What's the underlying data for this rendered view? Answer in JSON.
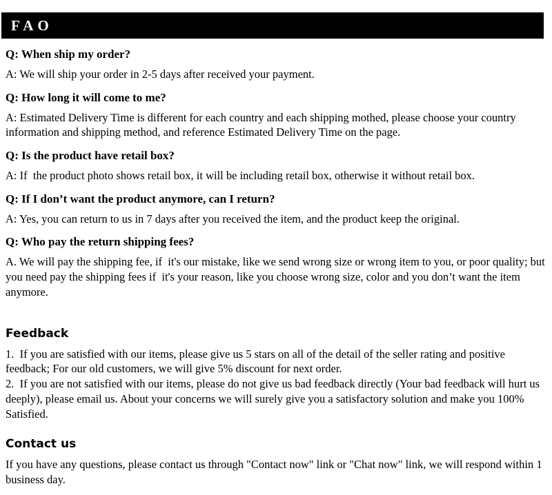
{
  "header": {
    "title": "FAO"
  },
  "faq": {
    "items": [
      {
        "question": "Q: When ship my order?",
        "answer": "A: We will ship your order in 2-5 days after received your payment."
      },
      {
        "question": "Q: How long it will come to me?",
        "answer": "A: Estimated Delivery Time is different for each country and each shipping mothed, please choose your country information and shipping method, and reference Estimated Delivery Time on the page."
      },
      {
        "question": "Q: Is the product have retail box?",
        "answer": "A: If  the product photo shows retail box, it will be including retail box, otherwise it without retail box."
      },
      {
        "question": "Q: If I don’t want the product anymore, can I return?",
        "answer": "A: Yes, you can return to us in 7 days after you received the item, and the product keep the original."
      },
      {
        "question": "Q: Who pay the return shipping fees?",
        "answer": "A. We will pay the shipping fee, if  it's our mistake, like we send wrong size or wrong item to you, or poor quality; but you need pay the shipping fees if  it's your reason, like you choose wrong size, color and you don’t want the item anymore."
      }
    ]
  },
  "feedback": {
    "heading": "Feedback",
    "item1": "1.  If you are satisfied with our items, please give us 5 stars on all of the detail of the seller rating and positive feedback; For our old customers, we will give 5% discount for next order.",
    "item2": "2.  If you are not satisfied with our items, please do not give us bad feedback directly (Your bad feedback will hurt us deeply), please email us. About your concerns we will surely give you a satisfactory solution and make you 100% Satisfied."
  },
  "contact": {
    "heading": "Contact us",
    "body": "If you have any questions, please contact us through \"Contact now\" link or \"Chat now\" link, we will respond within 1 business day."
  }
}
